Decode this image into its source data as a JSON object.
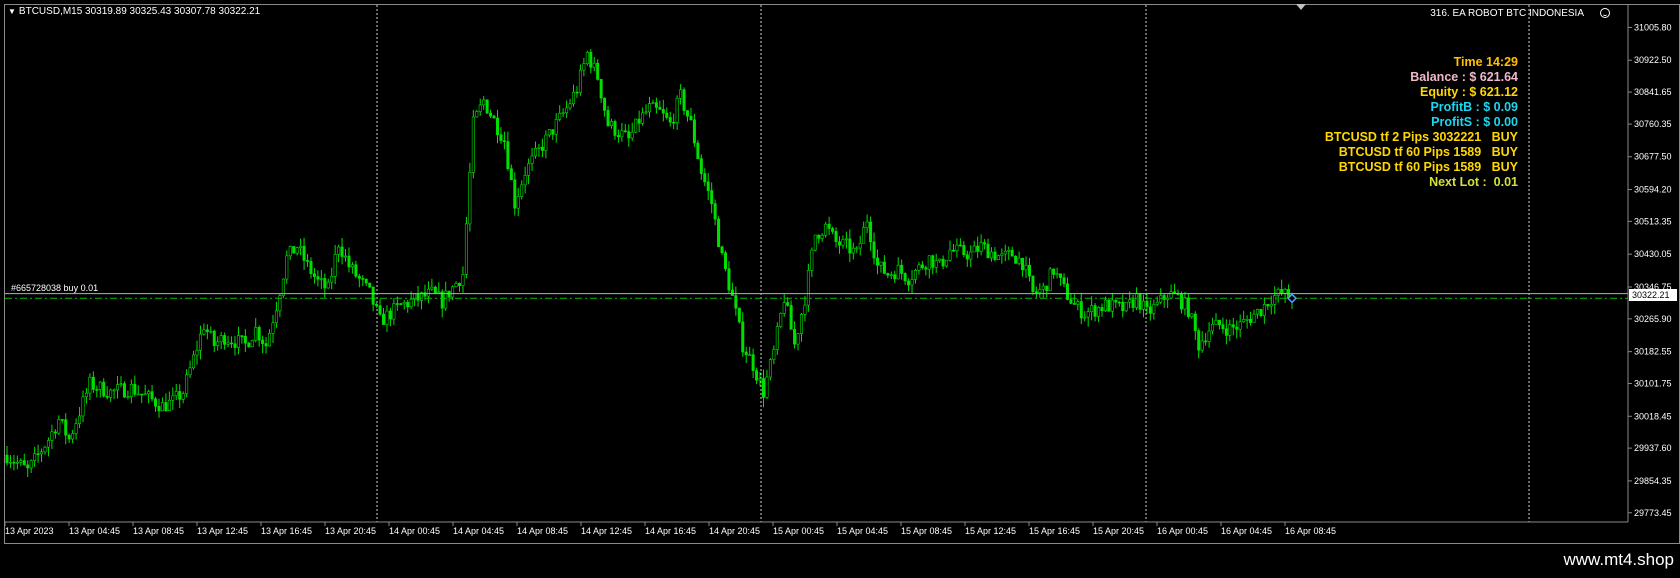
{
  "header": {
    "symbol_line": "BTCUSD,M15  30319.89 30325.43 30307.78 30322.21",
    "ea_name": "316. EA ROBOT BTC INDONESIA"
  },
  "info_panel": [
    {
      "text": "Time 14:29",
      "color": "#ffc000"
    },
    {
      "text": "Balance : $ 621.64",
      "color": "#f0b8c8"
    },
    {
      "text": "Equity : $ 621.12",
      "color": "#ffd700"
    },
    {
      "text": "ProfitB : $ 0.09",
      "color": "#1ad6f0"
    },
    {
      "text": "ProfitS : $ 0.00",
      "color": "#1ad6f0"
    },
    {
      "text": "BTCUSD tf 2 Pips 3032221   BUY",
      "color": "#ffd700"
    },
    {
      "text": "BTCUSD tf 60 Pips 1589   BUY",
      "color": "#ffd700"
    },
    {
      "text": "BTCUSD tf 60 Pips 1589   BUY",
      "color": "#ffd700"
    },
    {
      "text": "Next Lot :  0.01",
      "color": "#d4e03a"
    }
  ],
  "order_label": "#665728038 buy 0.01",
  "current_price_label": "30322.21",
  "watermark": "www.mt4.shop",
  "colors": {
    "candle": "#00e000",
    "order_line": "#00c000",
    "bid_line": "#a0b4c8",
    "grid_separator": "#d0d0d0",
    "axis_text": "#ffffff"
  },
  "chart_data": {
    "type": "candlestick",
    "symbol": "BTCUSD",
    "timeframe": "M15",
    "ylim": [
      29750,
      31045
    ],
    "y_ticks": [
      31005.8,
      30922.5,
      30841.65,
      30760.35,
      30677.5,
      30594.2,
      30513.35,
      30430.05,
      30346.75,
      30265.9,
      30182.55,
      30101.75,
      30018.45,
      29937.6,
      29854.35,
      29773.45
    ],
    "x_ticks": [
      "13 Apr 2023",
      "13 Apr 04:45",
      "13 Apr 08:45",
      "13 Apr 12:45",
      "13 Apr 16:45",
      "13 Apr 20:45",
      "14 Apr 00:45",
      "14 Apr 04:45",
      "14 Apr 08:45",
      "14 Apr 12:45",
      "14 Apr 16:45",
      "14 Apr 20:45",
      "15 Apr 00:45",
      "15 Apr 04:45",
      "15 Apr 08:45",
      "15 Apr 12:45",
      "15 Apr 16:45",
      "15 Apr 20:45",
      "16 Apr 00:45",
      "16 Apr 04:45",
      "16 Apr 08:45"
    ],
    "day_separators_after_tick": [
      5,
      11,
      17,
      20
    ],
    "order_price": 30318,
    "bid_price": 30322.21,
    "ohlc": {
      "open": 30319.89,
      "high": 30325.43,
      "low": 30307.78,
      "close": 30322.21
    },
    "close_path": [
      [
        0,
        29920
      ],
      [
        2,
        29880
      ],
      [
        4,
        29960
      ],
      [
        5,
        30010
      ],
      [
        6,
        29960
      ],
      [
        8,
        30100
      ],
      [
        10,
        30080
      ],
      [
        12,
        30090
      ],
      [
        14,
        30060
      ],
      [
        15,
        30045
      ],
      [
        16,
        30055
      ],
      [
        17,
        30080
      ],
      [
        19,
        30250
      ],
      [
        20,
        30200
      ],
      [
        21,
        30220
      ],
      [
        23,
        30200
      ],
      [
        24,
        30240
      ],
      [
        25,
        30200
      ],
      [
        26,
        30300
      ],
      [
        27,
        30420
      ],
      [
        28,
        30450
      ],
      [
        29,
        30400
      ],
      [
        30,
        30360
      ],
      [
        31,
        30340
      ],
      [
        32,
        30460
      ],
      [
        33,
        30400
      ],
      [
        35,
        30330
      ],
      [
        36,
        30260
      ],
      [
        37,
        30280
      ],
      [
        38,
        30300
      ],
      [
        40,
        30320
      ],
      [
        41,
        30330
      ],
      [
        42,
        30310
      ],
      [
        44,
        30380
      ],
      [
        45,
        30760
      ],
      [
        46,
        30820
      ],
      [
        48,
        30720
      ],
      [
        49,
        30560
      ],
      [
        50,
        30640
      ],
      [
        52,
        30720
      ],
      [
        54,
        30800
      ],
      [
        55,
        30850
      ],
      [
        56,
        30940
      ],
      [
        57,
        30880
      ],
      [
        58,
        30760
      ],
      [
        60,
        30720
      ],
      [
        61,
        30770
      ],
      [
        62,
        30800
      ],
      [
        63,
        30790
      ],
      [
        64,
        30760
      ],
      [
        65,
        30830
      ],
      [
        66,
        30760
      ],
      [
        67,
        30640
      ],
      [
        68,
        30560
      ],
      [
        69,
        30420
      ],
      [
        70,
        30320
      ],
      [
        71,
        30200
      ],
      [
        72,
        30150
      ],
      [
        73,
        30080
      ],
      [
        74,
        30180
      ],
      [
        75,
        30320
      ],
      [
        76,
        30200
      ],
      [
        77,
        30320
      ],
      [
        78,
        30480
      ],
      [
        79,
        30500
      ],
      [
        80,
        30460
      ],
      [
        81,
        30450
      ],
      [
        82,
        30430
      ],
      [
        83,
        30520
      ],
      [
        84,
        30400
      ],
      [
        85,
        30380
      ],
      [
        86,
        30390
      ],
      [
        87,
        30370
      ],
      [
        89,
        30420
      ],
      [
        90,
        30400
      ],
      [
        91,
        30440
      ],
      [
        93,
        30430
      ],
      [
        94,
        30450
      ],
      [
        96,
        30420
      ],
      [
        97,
        30430
      ],
      [
        98,
        30410
      ],
      [
        99,
        30330
      ],
      [
        100,
        30340
      ],
      [
        101,
        30390
      ],
      [
        102,
        30340
      ],
      [
        103,
        30300
      ],
      [
        104,
        30280
      ],
      [
        105,
        30290
      ],
      [
        106,
        30300
      ],
      [
        108,
        30290
      ],
      [
        109,
        30320
      ],
      [
        110,
        30280
      ],
      [
        111,
        30300
      ],
      [
        112,
        30330
      ],
      [
        113,
        30320
      ],
      [
        114,
        30290
      ],
      [
        115,
        30200
      ],
      [
        116,
        30240
      ],
      [
        117,
        30250
      ],
      [
        118,
        30240
      ],
      [
        119,
        30250
      ],
      [
        121,
        30290
      ],
      [
        122,
        30320
      ],
      [
        123,
        30330
      ],
      [
        124,
        30320
      ]
    ]
  }
}
